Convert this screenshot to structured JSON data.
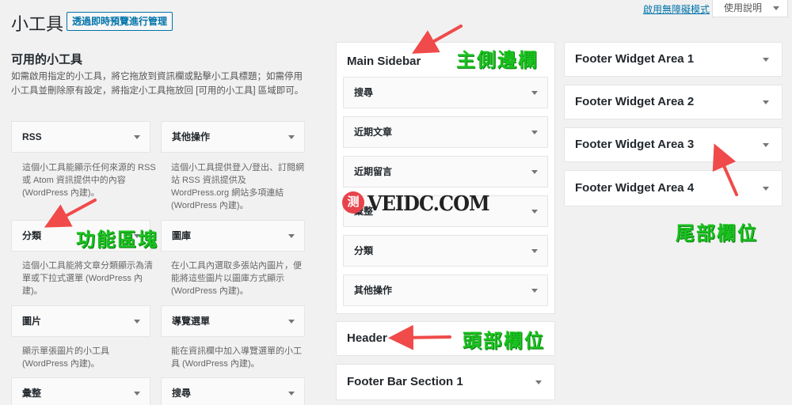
{
  "header": {
    "title": "小工具",
    "manage_live_preview": "透過即時預覽進行管理",
    "accessibility_mode": "啟用無障礙模式",
    "help": "使用說明"
  },
  "available": {
    "title": "可用的小工具",
    "description": "如需啟用指定的小工具，將它拖放到資訊欄或點擊小工具標題；如需停用小工具並刪除原有設定，將指定小工具拖放回 [可用的小工具] 區域即可。",
    "widgets": [
      {
        "name": "RSS",
        "desc": "這個小工具能顯示任何來源的 RSS 或 Atom 資訊提供中的內容 (WordPress 內建)。"
      },
      {
        "name": "其他操作",
        "desc": "這個小工具提供登入/登出、訂閱網站 RSS 資訊提供及 WordPress.org 網站多項連結 (WordPress 內建)。"
      },
      {
        "name": "分類",
        "desc": "這個小工具能將文章分類顯示為清單或下拉式選單 (WordPress 內建)。"
      },
      {
        "name": "圖庫",
        "desc": "在小工具內選取多張站內圖片，便能將這些圖片以圖庫方式顯示 (WordPress 內建)。"
      },
      {
        "name": "圖片",
        "desc": "顯示單張圖片的小工具 (WordPress 內建)。"
      },
      {
        "name": "導覽選單",
        "desc": "能在資訊欄中加入導覽選單的小工具 (WordPress 內建)。"
      },
      {
        "name": "彙整",
        "desc": ""
      },
      {
        "name": "搜尋",
        "desc": ""
      }
    ]
  },
  "main_sidebar": {
    "title": "Main Sidebar",
    "widgets": [
      "搜尋",
      "近期文章",
      "近期留言",
      "彙整",
      "分類",
      "其他操作"
    ]
  },
  "header_area": {
    "title": "Header"
  },
  "footer_bar": {
    "title": "Footer Bar Section 1"
  },
  "footer_areas": [
    {
      "title": "Footer Widget Area 1"
    },
    {
      "title": "Footer Widget Area 2"
    },
    {
      "title": "Footer Widget Area 3"
    },
    {
      "title": "Footer Widget Area 4"
    }
  ],
  "annotations": {
    "main_sidebar": "主側邊欄",
    "widget_blocks": "功能區塊",
    "header": "頭部欄位",
    "footer": "尾部欄位",
    "annotation_color": "#19c31e",
    "arrow_color": "#f04a4a"
  },
  "watermark": {
    "badge": "测",
    "text": "VEIDC.COM"
  }
}
